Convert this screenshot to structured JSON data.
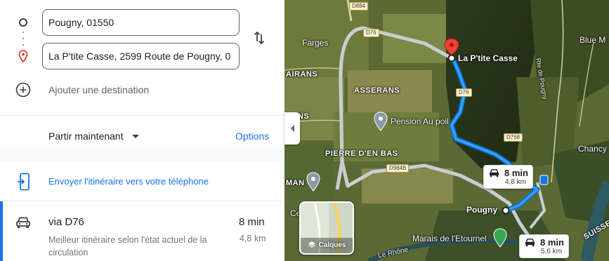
{
  "directions": {
    "origin": "Pougny, 01550",
    "destination": "La P'tite Casse, 2599 Route de Pougny, 0",
    "add_destination": "Ajouter une destination",
    "depart_label": "Partir maintenant",
    "options_label": "Options",
    "send_to_phone": "Envoyer l'itinéraire vers votre téléphone",
    "route": {
      "name": "via D76",
      "time": "8 min",
      "description": "Meilleur itinéraire selon l'état actuel de la circulation",
      "distance": "4,8 km"
    }
  },
  "map": {
    "places": {
      "farges": "Farges",
      "airans": "AIRANS",
      "asserans": "ASSERANS",
      "rans": "RANS",
      "pierre": "PIERRE D'EN BAS",
      "man": "MAN",
      "ce": "Ce",
      "destination": "La P'tite Casse",
      "pension": "Pension Au poil",
      "pougny": "Pougny",
      "marais": "Marais de l'Etournel",
      "rhone": "Le Rhône",
      "chancy": "Chancy",
      "blue": "Blue M",
      "route_pougny": "Rte de Pougny",
      "suisse": "SUISSE"
    },
    "roads": {
      "d884": "D884",
      "d76_top": "D76",
      "d76_mid": "D76",
      "d768": "D768",
      "d984b": "D984B"
    },
    "tooltip_main": {
      "time": "8 min",
      "distance": "4,8 km"
    },
    "tooltip_alt": {
      "time": "8 min",
      "distance": "5,6 km"
    },
    "layers_label": "Calques"
  },
  "colors": {
    "accent": "#1a73e8",
    "route_main": "#1a73e8",
    "route_alt": "#c9cdd3",
    "pin": "#ea4335"
  }
}
